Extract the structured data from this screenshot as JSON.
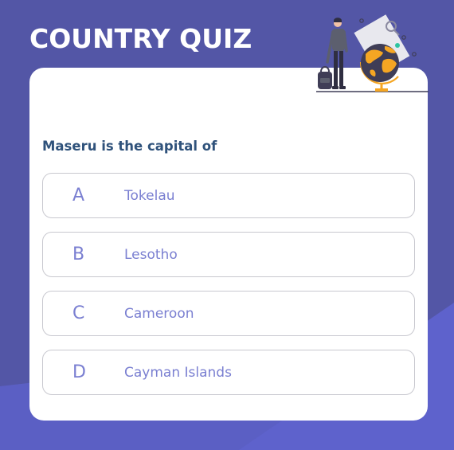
{
  "app": {
    "title": "COUNTRY QUIZ"
  },
  "illustration": {
    "name": "traveler-with-globe-icon"
  },
  "quiz": {
    "question": "Maseru is the capital of",
    "options": [
      {
        "letter": "A",
        "text": "Tokelau"
      },
      {
        "letter": "B",
        "text": "Lesotho"
      },
      {
        "letter": "C",
        "text": "Cameroon"
      },
      {
        "letter": "D",
        "text": "Cayman Islands"
      }
    ]
  },
  "colors": {
    "background": "#5356a6",
    "background_accent": "#5b5fc4",
    "card": "#ffffff",
    "question_text": "#2f527b",
    "option_text": "#7a7fd1",
    "option_border": "#c8c8cf"
  }
}
